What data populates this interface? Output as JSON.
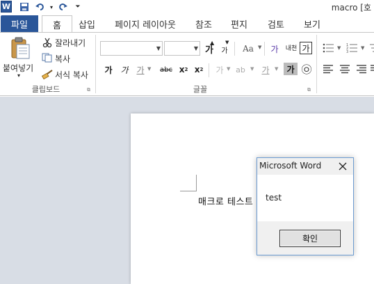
{
  "window": {
    "title": "macro [호"
  },
  "tabs": {
    "file": "파일",
    "home": "홈",
    "insert": "삽입",
    "layout": "페이지 레이아웃",
    "references": "참조",
    "mailings": "편지",
    "review": "검토",
    "view": "보기"
  },
  "clipboard": {
    "paste": "붙여넣기",
    "cut": "잘라내기",
    "copy": "복사",
    "format_painter": "서식 복사",
    "label": "클립보드"
  },
  "font": {
    "label": "글꼴",
    "grow": "가",
    "shrink": "가",
    "aa": "Aa",
    "clear_format": "가",
    "bold": "가",
    "italic": "가",
    "underline": "가",
    "strike": "가",
    "subscript": "x",
    "superscript": "x",
    "font_color": "가",
    "char_shading": "가",
    "enclose": "㉧",
    "phonetic": "내천",
    "border": "가"
  },
  "document": {
    "text": "매크로 테스트"
  },
  "dialog": {
    "title": "Microsoft Word",
    "message": "test",
    "ok": "확인"
  },
  "colors": {
    "file_tab": "#2a5699",
    "doc_background": "#d8dde5",
    "dialog_border": "#6b9bd1"
  }
}
